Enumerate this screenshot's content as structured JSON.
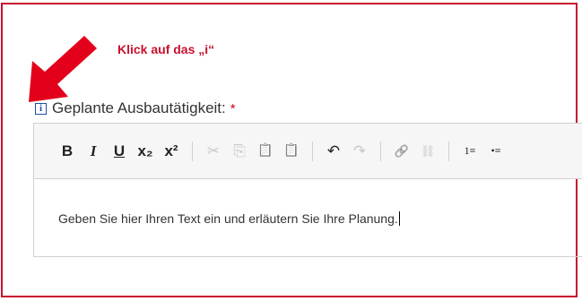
{
  "callout": {
    "text": "Klick auf das „i“",
    "color": "#c8102e"
  },
  "field": {
    "label": "Geplante Ausbautätigkeit:",
    "required_marker": "*",
    "info_icon": "i"
  },
  "toolbar": {
    "groups": [
      [
        {
          "name": "bold",
          "glyph": "B"
        },
        {
          "name": "italic",
          "glyph": "I"
        },
        {
          "name": "underline",
          "glyph": "U"
        },
        {
          "name": "subscript",
          "glyph": "x₂"
        },
        {
          "name": "superscript",
          "glyph": "x²"
        }
      ],
      [
        {
          "name": "cut",
          "glyph": "✂"
        },
        {
          "name": "copy",
          "glyph": "⎘"
        },
        {
          "name": "paste",
          "glyph": "📋"
        },
        {
          "name": "paste-text",
          "glyph": "📋"
        }
      ],
      [
        {
          "name": "undo",
          "glyph": "↶"
        },
        {
          "name": "redo",
          "glyph": "↷"
        }
      ],
      [
        {
          "name": "link",
          "glyph": "🔗"
        },
        {
          "name": "unlink",
          "glyph": "⛓"
        }
      ],
      [
        {
          "name": "numbered-list",
          "glyph": "1≡"
        },
        {
          "name": "bulleted-list",
          "glyph": "•≡"
        }
      ]
    ]
  },
  "editor": {
    "text": "Geben Sie hier Ihren Text ein und erläutern Sie Ihre Planung."
  }
}
